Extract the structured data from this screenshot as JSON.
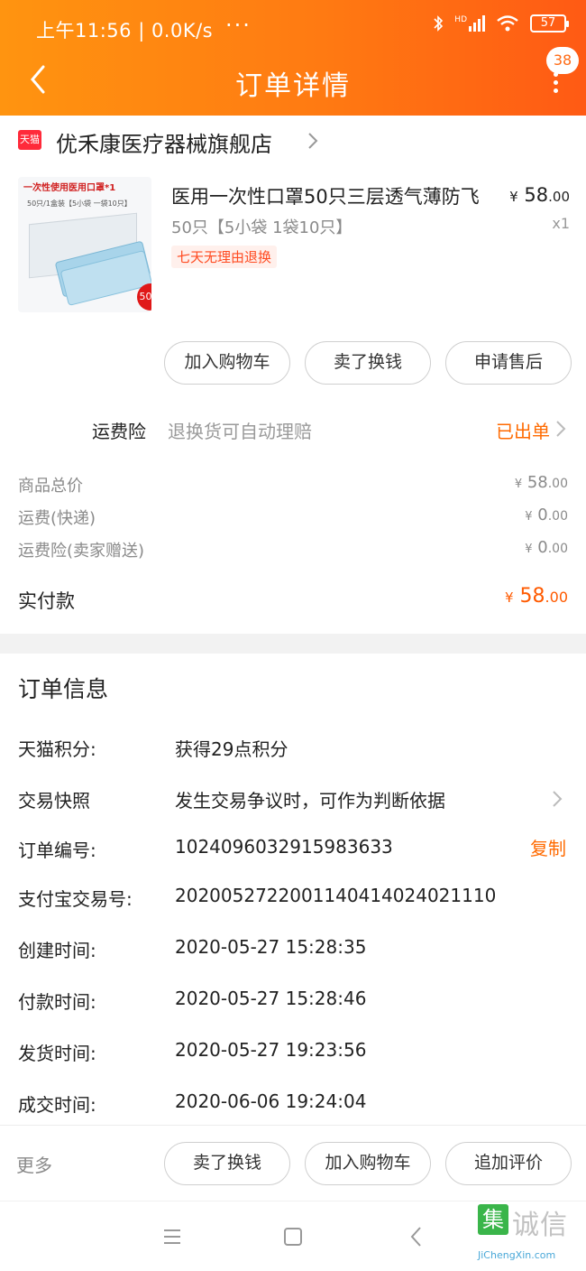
{
  "status_bar": {
    "time_speed": "上午11:56 | 0.0K/s",
    "dots": "···",
    "network": "HD",
    "battery": "57"
  },
  "nav": {
    "title": "订单详情",
    "message_count": "38"
  },
  "shop": {
    "logo_text": "天猫",
    "name": "优禾康医疗器械旗舰店"
  },
  "product": {
    "image": {
      "top_label": "一次性使用医用口罩*1",
      "sub_label": "50只/1盒装【5小袋 一袋10只】",
      "count_badge": "50只"
    },
    "title": "医用一次性口罩50只三层透气薄防飞",
    "sku": "50只【5小袋 1袋10只】",
    "return_tag": "七天无理由退换",
    "price_symbol": "¥",
    "price_int": "58",
    "price_dec": ".00",
    "quantity": "x1",
    "buttons": [
      "加入购物车",
      "卖了换钱",
      "申请售后"
    ]
  },
  "insurance": {
    "label": "运费险",
    "description": "退换货可自动理赔",
    "status": "已出单"
  },
  "price_rows": [
    {
      "label": "商品总价",
      "symbol": "¥",
      "int": "58",
      "dec": ".00"
    },
    {
      "label": "运费(快递)",
      "symbol": "¥",
      "int": "0",
      "dec": ".00"
    },
    {
      "label": "运费险(卖家赠送)",
      "symbol": "¥",
      "int": "0",
      "dec": ".00"
    }
  ],
  "paid": {
    "label": "实付款",
    "symbol": "¥",
    "int": "58",
    "dec": ".00"
  },
  "order_info": {
    "title": "订单信息",
    "copy_label": "复制",
    "rows": [
      {
        "label": "天猫积分:",
        "value": "获得29点积分"
      },
      {
        "label": "交易快照",
        "value": "发生交易争议时，可作为判断依据"
      },
      {
        "label": "订单编号:",
        "value": "1024096032915983633"
      },
      {
        "label": "支付宝交易号:",
        "value": "2020052722001140414024021110"
      },
      {
        "label": "创建时间:",
        "value": "2020-05-27 15:28:35"
      },
      {
        "label": "付款时间:",
        "value": "2020-05-27 15:28:46"
      },
      {
        "label": "发货时间:",
        "value": "2020-05-27 19:23:56"
      },
      {
        "label": "成交时间:",
        "value": "2020-06-06 19:24:04"
      }
    ]
  },
  "action_bar": {
    "more_label": "更多",
    "buttons": [
      "卖了换钱",
      "加入购物车",
      "追加评价"
    ]
  },
  "watermark": {
    "box_char": "集",
    "text": "诚信",
    "sub": "JiChengXin.com"
  },
  "colors": {
    "accent": "#ff6a00",
    "header_start": "#ff9410",
    "header_end": "#ff5a14"
  }
}
